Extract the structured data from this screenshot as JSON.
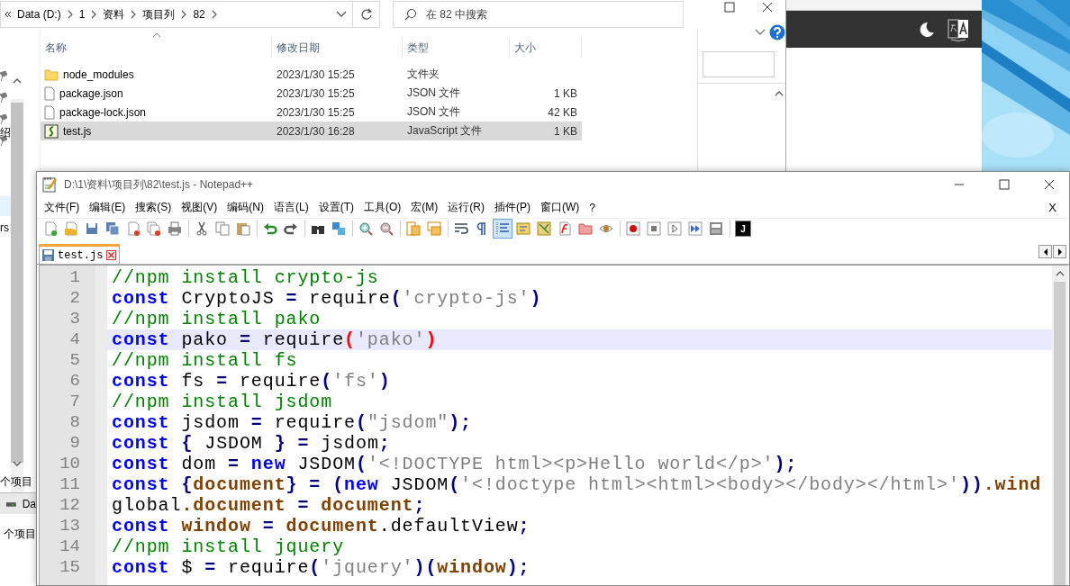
{
  "explorer": {
    "breadcrumb": [
      "Data (D:)",
      "1",
      "资料",
      "项目列",
      "82"
    ],
    "search": {
      "placeholder": "在 82 中搜索"
    },
    "columns": [
      "名称",
      "修改日期",
      "类型",
      "大小"
    ],
    "files": [
      {
        "kind": "folder",
        "name": "node_modules",
        "modified": "2023/1/30 15:25",
        "type": "文件夹",
        "selected": false
      },
      {
        "kind": "file",
        "name": "package.json",
        "modified": "2023/1/30 15:25",
        "type": "JSON 文件",
        "size": "1 KB",
        "selected": false
      },
      {
        "kind": "file",
        "name": "package-lock.json",
        "modified": "2023/1/30 15:25",
        "type": "JSON 文件",
        "size": "42 KB",
        "selected": false
      },
      {
        "kind": "script",
        "name": "test.js",
        "modified": "2023/1/30 16:28",
        "type": "JavaScript 文件",
        "size": "1 KB",
        "selected": true
      }
    ],
    "nav_fragments": [
      "绍",
      "rs"
    ],
    "status": "个项目"
  },
  "lower_window": {
    "drive": "Da",
    "status": "个项目"
  },
  "notepad": {
    "title": "D:\\1\\资料\\项目列\\82\\test.js - Notepad++",
    "menu": [
      "文件(F)",
      "编辑(E)",
      "搜索(S)",
      "视图(V)",
      "编码(N)",
      "语言(L)",
      "设置(T)",
      "工具(O)",
      "宏(M)",
      "运行(R)",
      "插件(P)",
      "窗口(W)",
      "?"
    ],
    "close_doc": "X",
    "toolbar": [
      {
        "pressed": false
      },
      {
        "pressed": false
      },
      {
        "pressed": false
      },
      {
        "pressed": false
      },
      {
        "pressed": false
      },
      {
        "pressed": false
      },
      {
        "pressed": false
      },
      {
        "pressed": false
      },
      {
        "pressed": false
      },
      {
        "pressed": false
      },
      {
        "pressed": false
      },
      {
        "pressed": false
      },
      {
        "pressed": false
      },
      {
        "pressed": false
      },
      {
        "pressed": false
      },
      {
        "pressed": false
      },
      {
        "pressed": false
      },
      {
        "pressed": false
      },
      {
        "pressed": false
      },
      {
        "pressed": false
      },
      {
        "pressed": true
      },
      {
        "pressed": false
      },
      {
        "pressed": false
      },
      {
        "pressed": false
      },
      {
        "pressed": false
      },
      {
        "pressed": false
      },
      {
        "pressed": false
      },
      {
        "pressed": false
      },
      {
        "pressed": false
      },
      {
        "pressed": false
      },
      {
        "pressed": false
      },
      {
        "pressed": false,
        "label": "J"
      }
    ],
    "tabs": [
      {
        "label": "test.js",
        "selected": true
      }
    ],
    "lines": [
      {
        "number": "1",
        "current": false,
        "tokens": [
          {
            "kind": "comment",
            "text": "//npm install crypto-js"
          }
        ]
      },
      {
        "number": "2",
        "current": false,
        "tokens": [
          {
            "kind": "keyword",
            "text": "const"
          },
          {
            "kind": "text",
            "text": " CryptoJS "
          },
          {
            "kind": "op",
            "text": "="
          },
          {
            "kind": "text",
            "text": " require"
          },
          {
            "kind": "op",
            "text": "("
          },
          {
            "kind": "string",
            "text": "'crypto-js'"
          },
          {
            "kind": "op",
            "text": ")"
          }
        ]
      },
      {
        "number": "3",
        "current": false,
        "tokens": [
          {
            "kind": "comment",
            "text": "//npm install pako"
          }
        ]
      },
      {
        "number": "4",
        "current": true,
        "tokens": [
          {
            "kind": "keyword",
            "text": "const"
          },
          {
            "kind": "text",
            "text": " pako "
          },
          {
            "kind": "op",
            "text": "="
          },
          {
            "kind": "text",
            "text": " require"
          },
          {
            "kind": "brace",
            "text": "("
          },
          {
            "kind": "string",
            "text": "'pako'"
          },
          {
            "kind": "brace",
            "text": ")"
          }
        ]
      },
      {
        "number": "5",
        "current": false,
        "tokens": [
          {
            "kind": "comment",
            "text": "//npm install fs"
          }
        ]
      },
      {
        "number": "6",
        "current": false,
        "tokens": [
          {
            "kind": "keyword",
            "text": "const"
          },
          {
            "kind": "text",
            "text": " fs "
          },
          {
            "kind": "op",
            "text": "="
          },
          {
            "kind": "text",
            "text": " require"
          },
          {
            "kind": "op",
            "text": "("
          },
          {
            "kind": "string",
            "text": "'fs'"
          },
          {
            "kind": "op",
            "text": ")"
          }
        ]
      },
      {
        "number": "7",
        "current": false,
        "tokens": [
          {
            "kind": "comment",
            "text": "//npm install jsdom"
          }
        ]
      },
      {
        "number": "8",
        "current": false,
        "tokens": [
          {
            "kind": "keyword",
            "text": "const"
          },
          {
            "kind": "text",
            "text": " jsdom "
          },
          {
            "kind": "op",
            "text": "="
          },
          {
            "kind": "text",
            "text": " require"
          },
          {
            "kind": "op",
            "text": "("
          },
          {
            "kind": "string",
            "text": "\"jsdom\""
          },
          {
            "kind": "op",
            "text": ");"
          }
        ]
      },
      {
        "number": "9",
        "current": false,
        "tokens": [
          {
            "kind": "keyword",
            "text": "const"
          },
          {
            "kind": "op",
            "text": " {"
          },
          {
            "kind": "text",
            "text": " JSDOM "
          },
          {
            "kind": "op",
            "text": "} ="
          },
          {
            "kind": "text",
            "text": " jsdom"
          },
          {
            "kind": "op",
            "text": ";"
          }
        ]
      },
      {
        "number": "10",
        "current": false,
        "tokens": [
          {
            "kind": "keyword",
            "text": "const"
          },
          {
            "kind": "text",
            "text": " dom "
          },
          {
            "kind": "op",
            "text": "="
          },
          {
            "kind": "keyword",
            "text": " new"
          },
          {
            "kind": "text",
            "text": " JSDOM"
          },
          {
            "kind": "op",
            "text": "("
          },
          {
            "kind": "string",
            "text": "'<!DOCTYPE html><p>Hello world</p>'"
          },
          {
            "kind": "op",
            "text": ");"
          }
        ]
      },
      {
        "number": "11",
        "current": false,
        "tokens": [
          {
            "kind": "keyword",
            "text": "const"
          },
          {
            "kind": "op",
            "text": " {"
          },
          {
            "kind": "var",
            "text": "document"
          },
          {
            "kind": "op",
            "text": "} = ("
          },
          {
            "kind": "keyword",
            "text": "new"
          },
          {
            "kind": "text",
            "text": " JSDOM"
          },
          {
            "kind": "op",
            "text": "("
          },
          {
            "kind": "string",
            "text": "'<!doctype html><html><body></body></html>'"
          },
          {
            "kind": "op",
            "text": "))"
          },
          {
            "kind": "var",
            "text": ".wind"
          }
        ]
      },
      {
        "number": "12",
        "current": false,
        "tokens": [
          {
            "kind": "text",
            "text": "global"
          },
          {
            "kind": "var",
            "text": ".document"
          },
          {
            "kind": "op",
            "text": " ="
          },
          {
            "kind": "var",
            "text": " document"
          },
          {
            "kind": "op",
            "text": ";"
          }
        ]
      },
      {
        "number": "13",
        "current": false,
        "tokens": [
          {
            "kind": "keyword",
            "text": "const"
          },
          {
            "kind": "var",
            "text": " window"
          },
          {
            "kind": "op",
            "text": " ="
          },
          {
            "kind": "var",
            "text": " document"
          },
          {
            "kind": "text",
            "text": ".defaultView"
          },
          {
            "kind": "op",
            "text": ";"
          }
        ]
      },
      {
        "number": "14",
        "current": false,
        "tokens": [
          {
            "kind": "comment",
            "text": "//npm install jquery"
          }
        ]
      },
      {
        "number": "15",
        "current": false,
        "tokens": [
          {
            "kind": "keyword",
            "text": "const"
          },
          {
            "kind": "text",
            "text": " $ "
          },
          {
            "kind": "op",
            "text": "="
          },
          {
            "kind": "text",
            "text": " require"
          },
          {
            "kind": "op",
            "text": "("
          },
          {
            "kind": "string",
            "text": "'jquery'"
          },
          {
            "kind": "op",
            "text": ")("
          },
          {
            "kind": "var",
            "text": "window"
          },
          {
            "kind": "op",
            "text": ");"
          }
        ]
      }
    ]
  }
}
